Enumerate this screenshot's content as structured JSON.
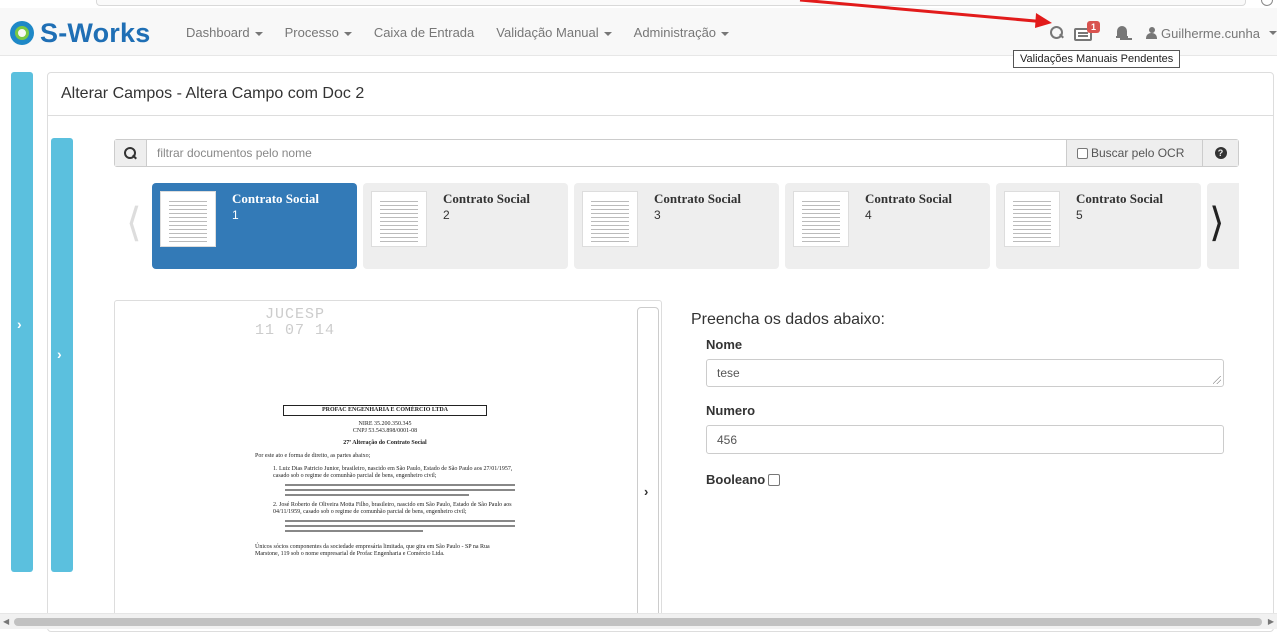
{
  "brand": {
    "name": "S-Works"
  },
  "nav": {
    "items": [
      {
        "label": "Dashboard",
        "dropdown": true
      },
      {
        "label": "Processo",
        "dropdown": true
      },
      {
        "label": "Caixa de Entrada",
        "dropdown": false
      },
      {
        "label": "Validação Manual",
        "dropdown": true
      },
      {
        "label": "Administração",
        "dropdown": true
      }
    ],
    "pending_count": "1",
    "user": "Guilherme.cunha",
    "tooltip": "Validações Manuais Pendentes"
  },
  "panel": {
    "title": "Alterar Campos - Altera Campo com Doc 2"
  },
  "search": {
    "placeholder": "filtrar documentos pelo nome",
    "ocr_label": "Buscar pelo OCR"
  },
  "documents": [
    {
      "title": "Contrato Social",
      "number": "1",
      "active": true
    },
    {
      "title": "Contrato Social",
      "number": "2",
      "active": false
    },
    {
      "title": "Contrato Social",
      "number": "3",
      "active": false
    },
    {
      "title": "Contrato Social",
      "number": "4",
      "active": false
    },
    {
      "title": "Contrato Social",
      "number": "5",
      "active": false
    }
  ],
  "viewer": {
    "stamp_line1": "JUCESP",
    "stamp_line2": "11 07 14",
    "company": "PROFAC ENGENHARIA E COMÉRCIO LTDA",
    "nire": "NIRE 35.200.350.345",
    "cnpj": "CNPJ 53.543.898/0001-08",
    "alteration": "27ª Alteração do Contrato Social",
    "intro": "Por este ato e forma de direito, as partes abaixo;",
    "item1": "1. Luiz Dias Patricio Junior, brasileiro, nascido em São Paulo, Estado de São Paulo aos 27/01/1957, casado sob o regime de comunhão parcial de bens, engenheiro civil;",
    "item2": "2. José Roberto de Oliveira Motta Filho, brasileiro, nascido em São Paulo, Estado de São Paulo aos 04/11/1959, casado sob o regime de comunhão parcial de bens, engenheiro civil;",
    "closing": "Únicos sócios componentes da sociedade empresária limitada, que gira em São Paulo - SP na Rua Marstone, 119 sob o nome empresarial de Profac Engenharia e Comércio Ltda."
  },
  "form": {
    "title": "Preencha os dados abaixo:",
    "nome_label": "Nome",
    "nome_value": "tese",
    "numero_label": "Numero",
    "numero_value": "456",
    "booleano_label": "Booleano"
  },
  "colors": {
    "accent": "#337ab7",
    "sidebar": "#5bc0de",
    "badge": "#d9534f",
    "brand": "#1f6fb5"
  }
}
